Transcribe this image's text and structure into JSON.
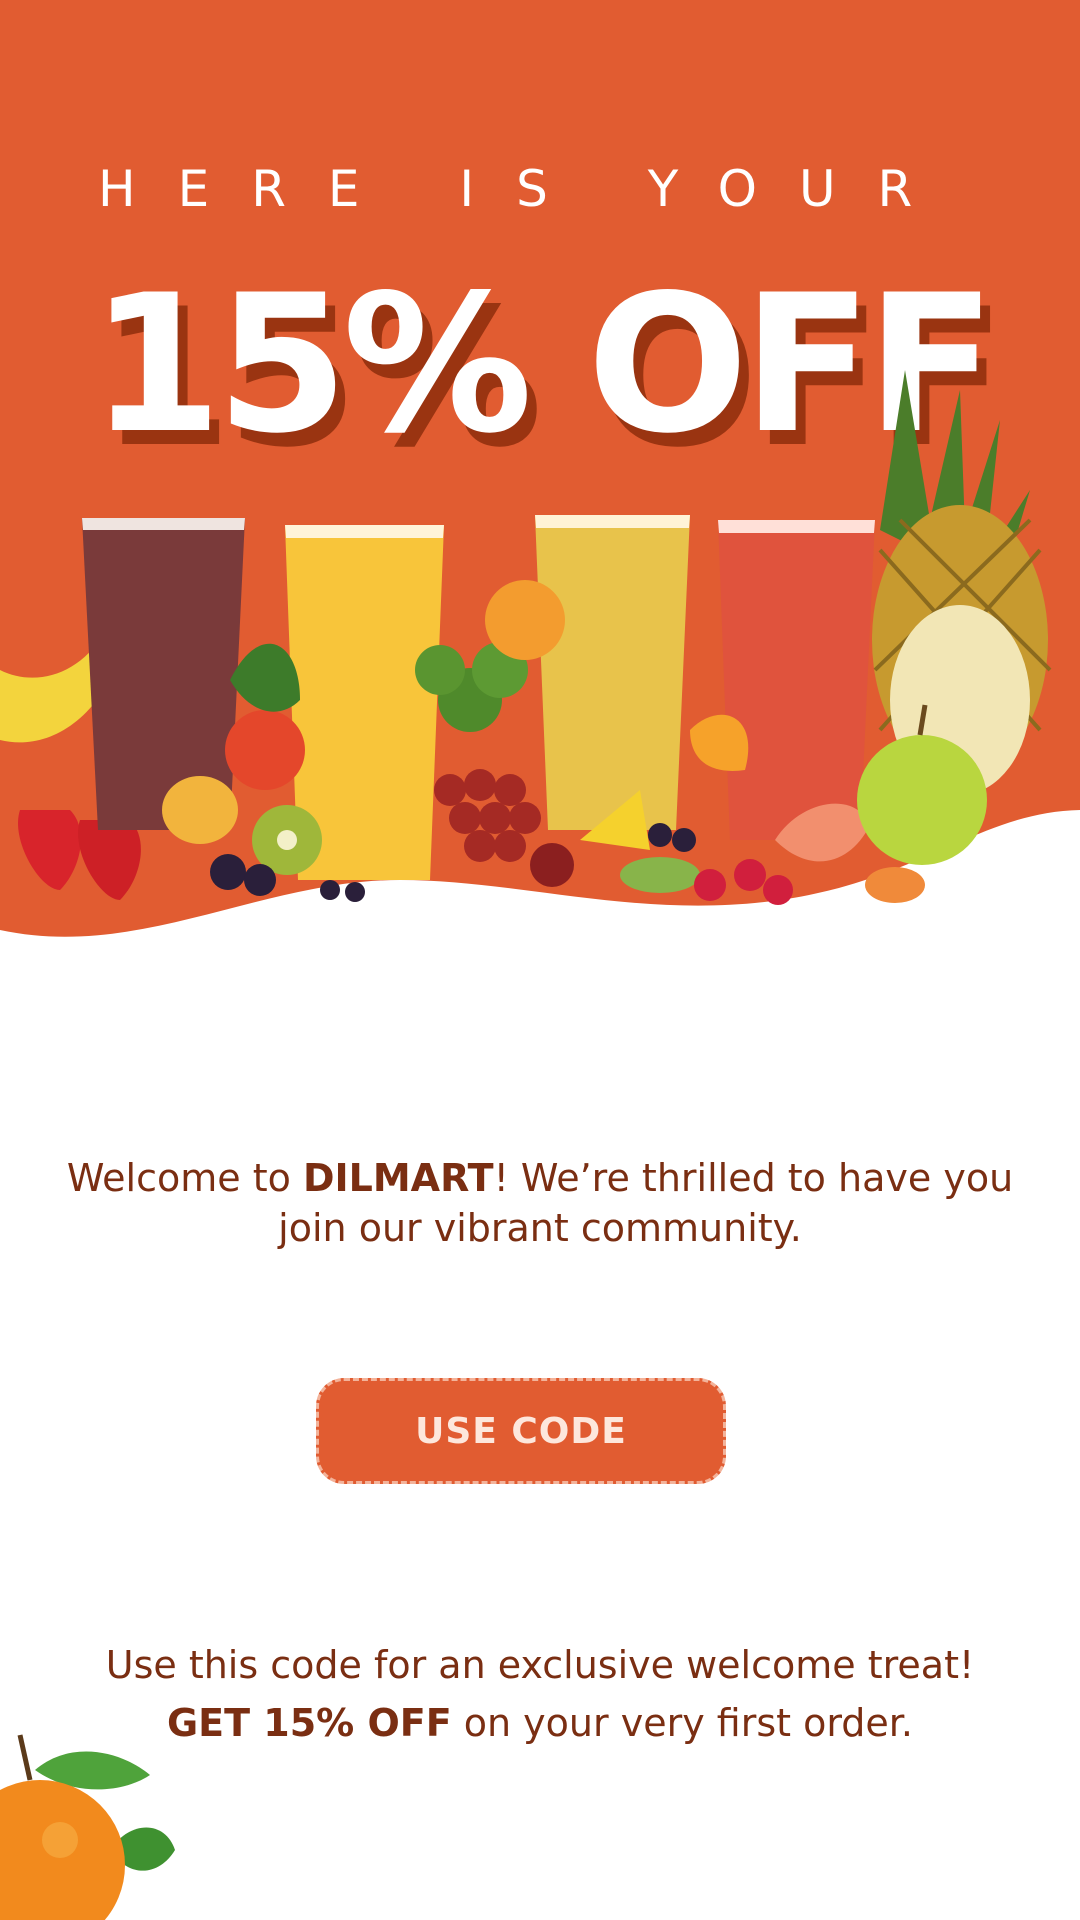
{
  "colors": {
    "brand_orange": "#e15c31",
    "dark_brown": "#7a2e12",
    "white": "#ffffff"
  },
  "hero": {
    "kicker": "HERE IS YOUR",
    "headline": "15% OFF"
  },
  "welcome": {
    "prefix": "Welcome to ",
    "brand": "DILMART",
    "suffix": "! We’re thrilled to have you join our vibrant community."
  },
  "cta": {
    "label": "USE CODE"
  },
  "promo": {
    "line1": "Use this code for an exclusive welcome treat!",
    "highlight": "GET 15% OFF",
    "line2_rest": " on your very first order."
  },
  "icons": {
    "produce": "fruit-and-smoothies-illustration",
    "corner": "orange-fruit-icon"
  }
}
